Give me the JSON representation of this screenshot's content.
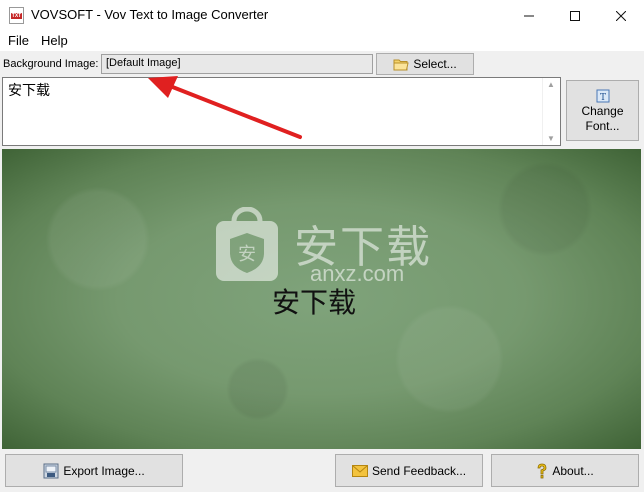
{
  "window": {
    "title": "VOVSOFT - Vov Text to Image Converter",
    "app_icon_label": "TXT"
  },
  "menu": {
    "items": [
      "File",
      "Help"
    ]
  },
  "toolbar": {
    "background_label": "Background Image:",
    "background_value": "[Default Image]",
    "select_label": "Select..."
  },
  "editor": {
    "text": "安下载"
  },
  "font_button": {
    "line1": "Change",
    "line2": "Font..."
  },
  "preview": {
    "text": "安下载",
    "watermark_text": "安下载",
    "watermark_domain": "anxz.com"
  },
  "bottom": {
    "export_label": "Export Image...",
    "feedback_label": "Send Feedback...",
    "about_label": "About..."
  },
  "colors": {
    "annotation_arrow": "#e02020",
    "preview_bg": "#76996f"
  },
  "icons": [
    "app-icon",
    "minimize-icon",
    "maximize-icon",
    "close-icon",
    "folder-icon",
    "font-icon",
    "export-icon",
    "envelope-icon",
    "help-icon"
  ]
}
